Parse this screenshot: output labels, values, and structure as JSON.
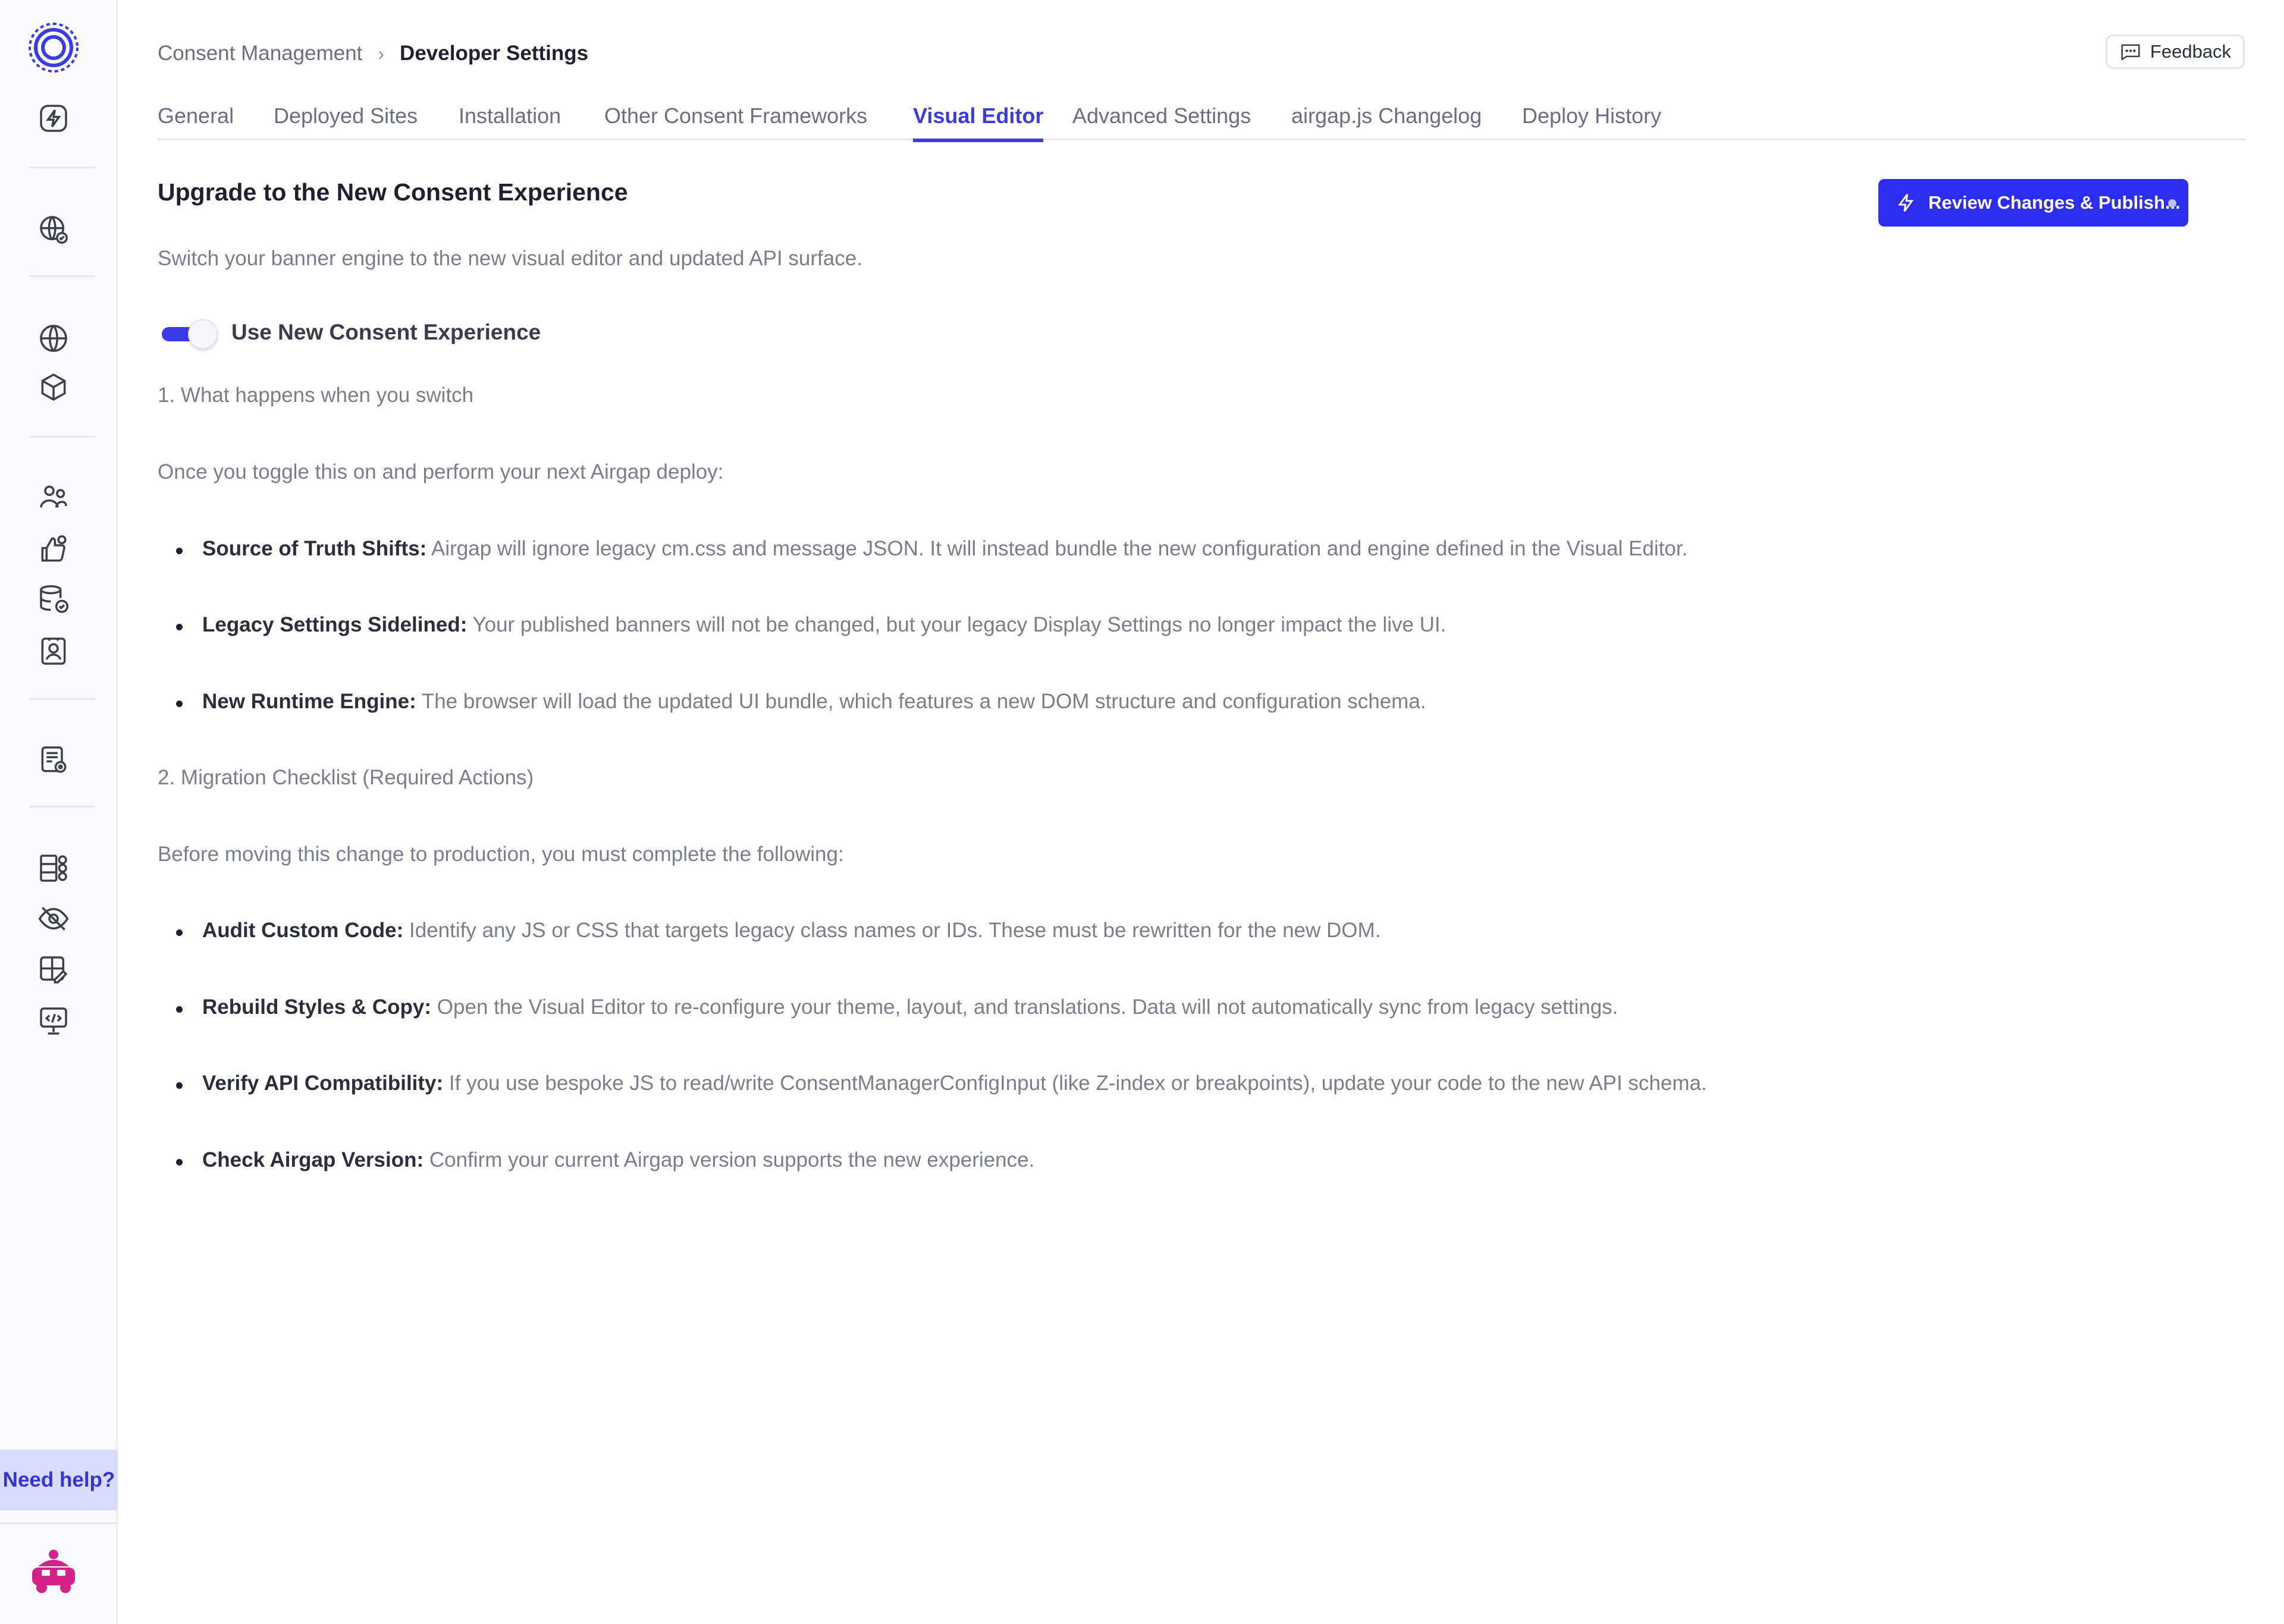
{
  "breadcrumb": {
    "parent": "Consent Management",
    "separator": "›",
    "current": "Developer Settings"
  },
  "feedback": {
    "label": "Feedback"
  },
  "tabs": [
    {
      "label": "General"
    },
    {
      "label": "Deployed Sites"
    },
    {
      "label": "Installation"
    },
    {
      "label": "Other Consent Frameworks"
    },
    {
      "label": "Visual Editor",
      "active": true
    },
    {
      "label": "Advanced Settings"
    },
    {
      "label": "airgap.js Changelog"
    },
    {
      "label": "Deploy History"
    }
  ],
  "main": {
    "title": "Upgrade to the New Consent Experience",
    "subtitle": "Switch your banner engine to the new visual editor and updated API surface.",
    "publish_label": "Review Changes & Publish...",
    "toggle": {
      "label": "Use New Consent Experience",
      "on": true
    },
    "section1": {
      "heading": "1. What happens when you switch",
      "intro": "Once you toggle this on and perform your next Airgap deploy:",
      "items": [
        {
          "title": "Source of Truth Shifts:",
          "text": " Airgap will ignore legacy cm.css and message JSON. It will instead bundle the new configuration and engine defined in the Visual Editor."
        },
        {
          "title": "Legacy Settings Sidelined:",
          "text": " Your published banners will not be changed, but your legacy Display Settings no longer impact the live UI."
        },
        {
          "title": "New Runtime Engine:",
          "text": " The browser will load the updated UI bundle, which features a new DOM structure and configuration schema."
        }
      ]
    },
    "section2": {
      "heading": "2. Migration Checklist (Required Actions)",
      "intro": "Before moving this change to production, you must complete the following:",
      "items": [
        {
          "title": "Audit Custom Code:",
          "text": " Identify any JS or CSS that targets legacy class names or IDs. These must be rewritten for the new DOM."
        },
        {
          "title": "Rebuild Styles & Copy:",
          "text": " Open the Visual Editor to re-configure your theme, layout, and translations. Data will not automatically sync from legacy settings."
        },
        {
          "title": "Verify API Compatibility:",
          "text": " If you use bespoke JS to read/write ConsentManagerConfigInput (like Z-index or breakpoints), update your code to the new API schema."
        },
        {
          "title": "Check Airgap Version:",
          "text": " Confirm your current Airgap version supports the new experience."
        }
      ]
    }
  },
  "sidebar": {
    "icons": [
      "flash-icon",
      "globe-shield-icon",
      "globe-icon",
      "cube-icon",
      "users-icon",
      "thumbs-up-icon",
      "database-check-icon",
      "contact-icon",
      "document-gear-icon",
      "apps-icon",
      "eye-off-icon",
      "grid-edit-icon",
      "code-monitor-icon"
    ],
    "need_help": "Need help?"
  },
  "colors": {
    "accent": "#3a3ae6",
    "button": "#2d2df0",
    "mascot": "#d4228a",
    "text": "#1f2130",
    "muted": "#7a7d8c"
  }
}
